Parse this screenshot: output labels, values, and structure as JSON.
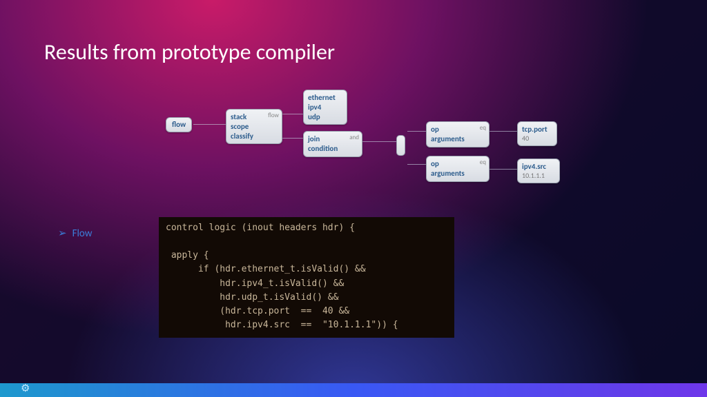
{
  "title": "Results from prototype compiler",
  "bullet": {
    "label": "Flow"
  },
  "diagram": {
    "flow": {
      "label": "flow"
    },
    "ssc": {
      "l1": "stack",
      "l2": "scope",
      "l3": "classify",
      "tag": "flow"
    },
    "proto": {
      "l1": "ethernet",
      "l2": "ipv4",
      "l3": "udp"
    },
    "join": {
      "l1": "join",
      "l2": "condition",
      "tag": "and"
    },
    "op1": {
      "l1": "op",
      "l2": "arguments",
      "tag": "eq"
    },
    "op2": {
      "l1": "op",
      "l2": "arguments",
      "tag": "eq"
    },
    "tcp": {
      "l1": "tcp.port",
      "l2": "40"
    },
    "ipv4src": {
      "l1": "ipv4.src",
      "l2": "10.1.1.1"
    }
  },
  "code": {
    "l1": "control logic (inout headers hdr) {",
    "l2": "",
    "l3": " apply {",
    "l4": "      if (hdr.ethernet_t.isValid() &&",
    "l5": "          hdr.ipv4_t.isValid() &&",
    "l6": "          hdr.udp_t.isValid() &&",
    "l7": "          (hdr.tcp.port  ==  40 &&",
    "l8": "           hdr.ipv4.src  ==  \"10.1.1.1\")) {"
  }
}
